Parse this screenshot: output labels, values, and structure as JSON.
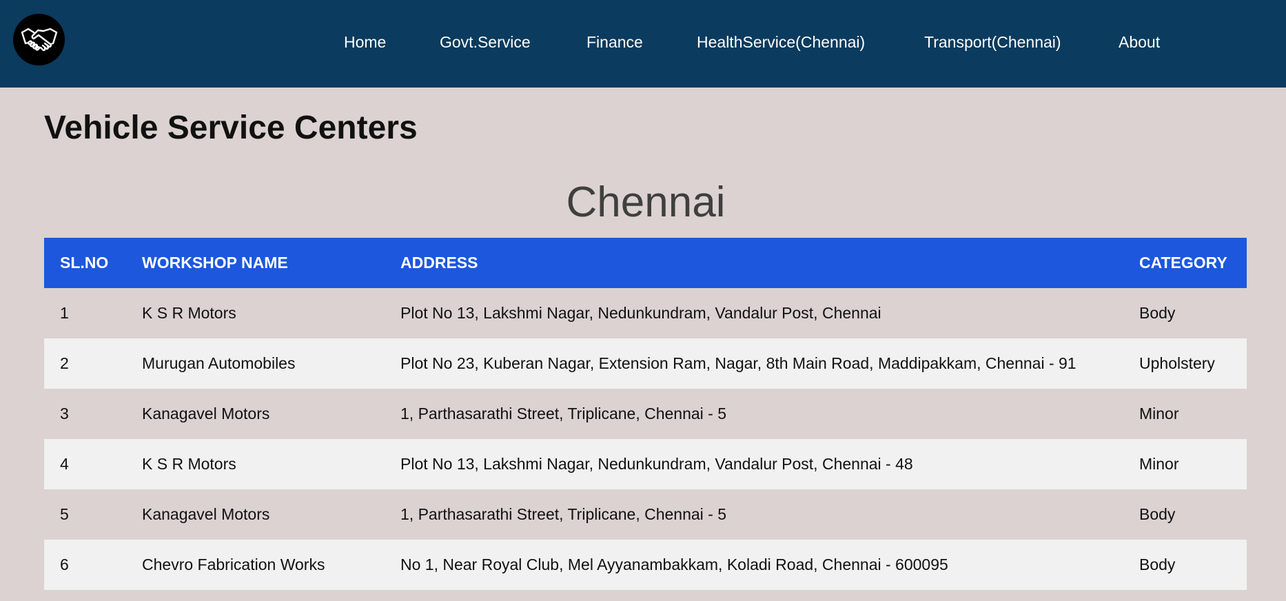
{
  "nav": {
    "logo_icon": "handshake-icon",
    "links": [
      {
        "label": "Home"
      },
      {
        "label": "Govt.Service"
      },
      {
        "label": "Finance"
      },
      {
        "label": "HealthService(Chennai)"
      },
      {
        "label": "Transport(Chennai)"
      },
      {
        "label": "About"
      }
    ]
  },
  "page": {
    "title": "Vehicle Service Centers",
    "city": "Chennai"
  },
  "table": {
    "headers": {
      "sl": "SL.NO",
      "name": "WORKSHOP NAME",
      "address": "ADDRESS",
      "category": "CATEGORY"
    },
    "rows": [
      {
        "sl": "1",
        "name": "K S R Motors",
        "address": "Plot No 13, Lakshmi Nagar, Nedunkundram, Vandalur Post, Chennai",
        "category": "Body"
      },
      {
        "sl": "2",
        "name": "Murugan Automobiles",
        "address": "Plot No 23, Kuberan Nagar, Extension Ram, Nagar, 8th Main Road, Maddipakkam, Chennai - 91",
        "category": "Upholstery"
      },
      {
        "sl": "3",
        "name": "Kanagavel Motors",
        "address": "1, Parthasarathi Street, Triplicane, Chennai - 5",
        "category": "Minor"
      },
      {
        "sl": "4",
        "name": "K S R Motors",
        "address": "Plot No 13, Lakshmi Nagar, Nedunkundram, Vandalur Post, Chennai - 48",
        "category": "Minor"
      },
      {
        "sl": "5",
        "name": "Kanagavel Motors",
        "address": "1, Parthasarathi Street, Triplicane, Chennai - 5",
        "category": "Body"
      },
      {
        "sl": "6",
        "name": "Chevro Fabrication Works",
        "address": "No 1, Near Royal Club, Mel Ayyanambakkam, Koladi Road, Chennai - 600095",
        "category": "Body"
      }
    ]
  },
  "colors": {
    "navbar": "#0b3b5e",
    "page_background": "#dbd2d1",
    "table_header": "#1c57de",
    "row_alt": "#f1f1f1"
  }
}
